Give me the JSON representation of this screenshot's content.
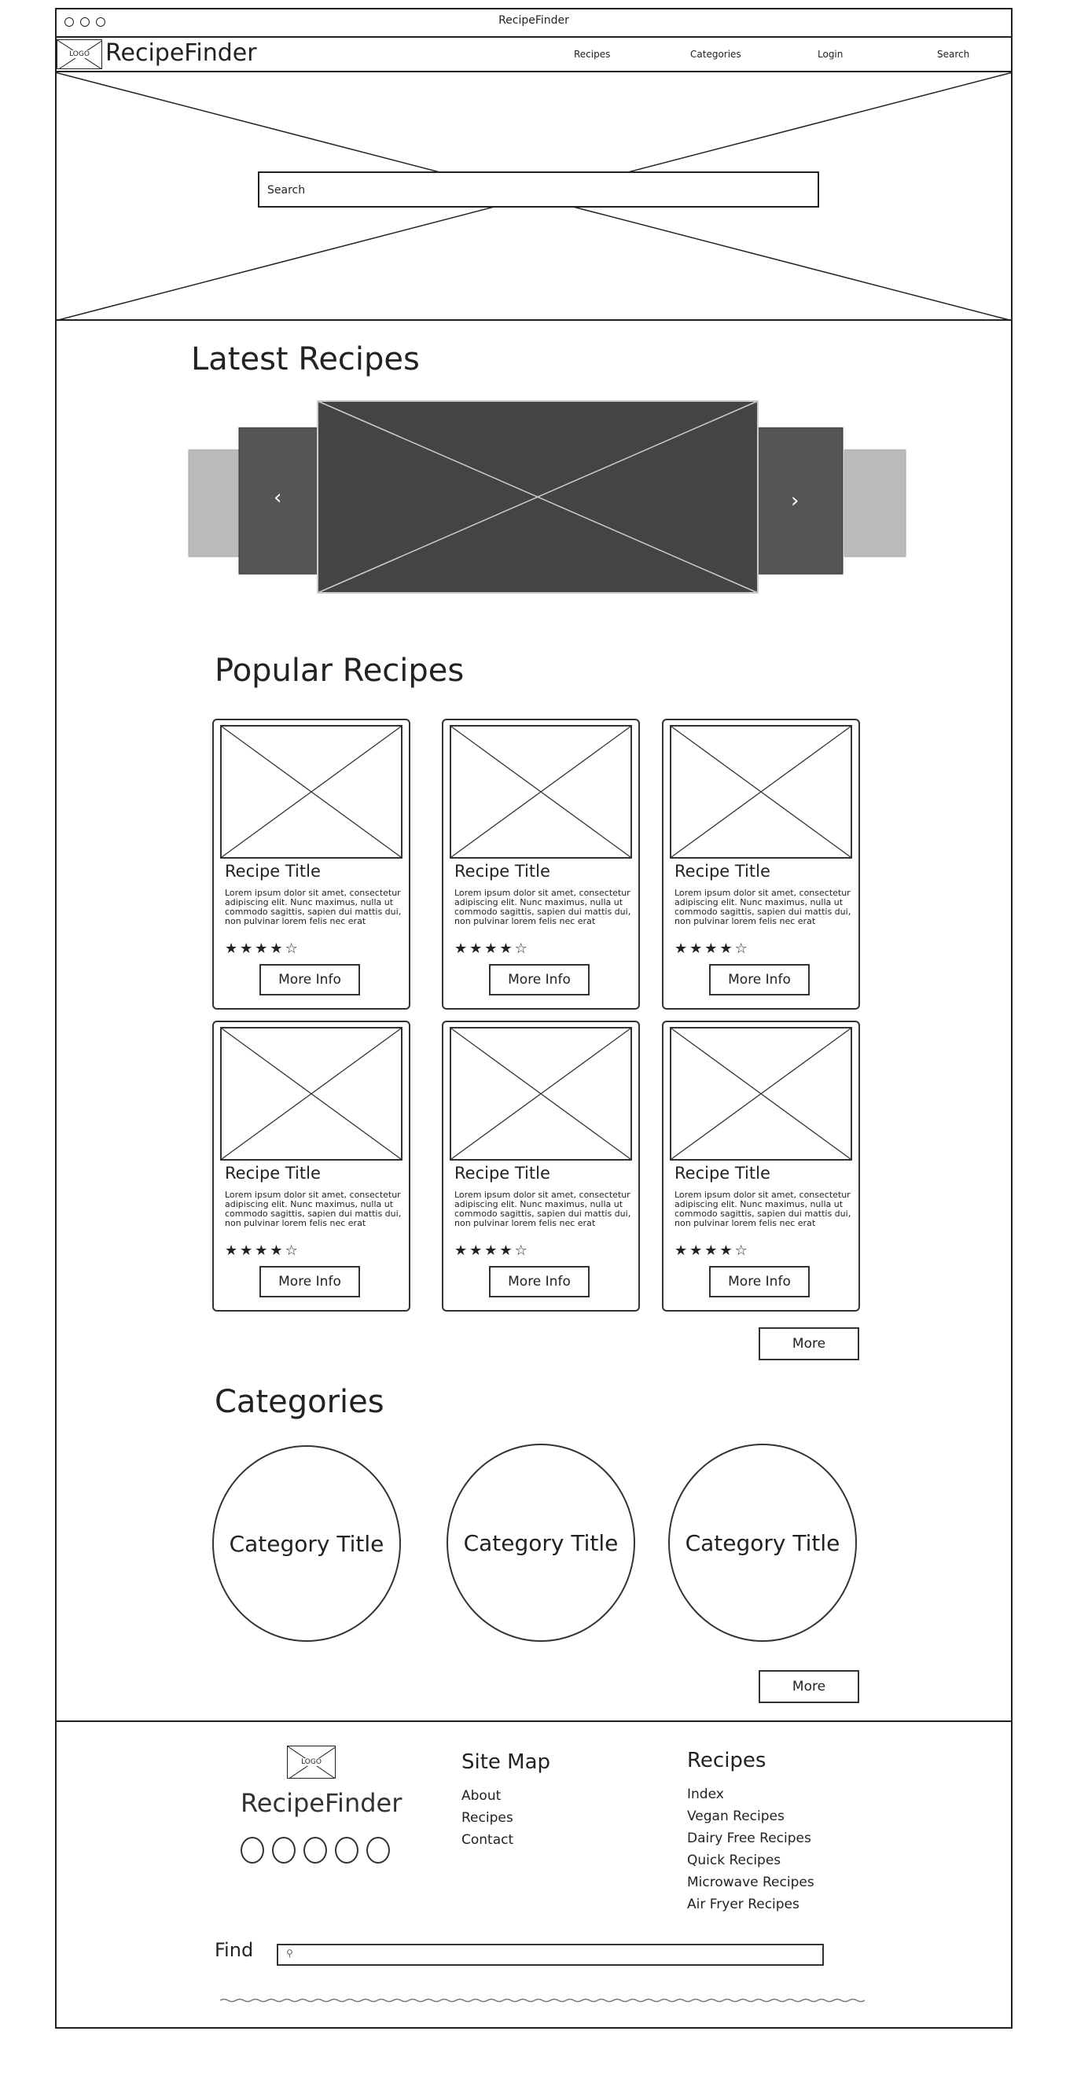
{
  "window": {
    "title": "RecipeFinder"
  },
  "nav": {
    "logo": "LOGO",
    "brand": "RecipeFinder",
    "links": [
      "Recipes",
      "Categories",
      "Login",
      "Search"
    ]
  },
  "hero": {
    "search_placeholder": "Search"
  },
  "latest": {
    "heading": "Latest Recipes",
    "prev": "‹",
    "next": "›"
  },
  "popular": {
    "heading": "Popular Recipes",
    "cards": [
      {
        "title": "Recipe Title",
        "text": "Lorem ipsum dolor sit amet, consectetur adipiscing elit. Nunc maximus, nulla ut commodo sagittis, sapien dui mattis dui, non pulvinar lorem felis nec erat",
        "rating": 4,
        "button": "More Info"
      },
      {
        "title": "Recipe Title",
        "text": "Lorem ipsum dolor sit amet, consectetur adipiscing elit. Nunc maximus, nulla ut commodo sagittis, sapien dui mattis dui, non pulvinar lorem felis nec erat",
        "rating": 4,
        "button": "More Info"
      },
      {
        "title": "Recipe Title",
        "text": "Lorem ipsum dolor sit amet, consectetur adipiscing elit. Nunc maximus, nulla ut commodo sagittis, sapien dui mattis dui, non pulvinar lorem felis nec erat",
        "rating": 4,
        "button": "More Info"
      },
      {
        "title": "Recipe Title",
        "text": "Lorem ipsum dolor sit amet, consectetur adipiscing elit. Nunc maximus, nulla ut commodo sagittis, sapien dui mattis dui, non pulvinar lorem felis nec erat",
        "rating": 4,
        "button": "More Info"
      },
      {
        "title": "Recipe Title",
        "text": "Lorem ipsum dolor sit amet, consectetur adipiscing elit. Nunc maximus, nulla ut commodo sagittis, sapien dui mattis dui, non pulvinar lorem felis nec erat",
        "rating": 4,
        "button": "More Info"
      },
      {
        "title": "Recipe Title",
        "text": "Lorem ipsum dolor sit amet, consectetur adipiscing elit. Nunc maximus, nulla ut commodo sagittis, sapien dui mattis dui, non pulvinar lorem felis nec erat",
        "rating": 4,
        "button": "More Info"
      }
    ],
    "more": "More"
  },
  "categories": {
    "heading": "Categories",
    "items": [
      "Category Title",
      "Category Title",
      "Category Title"
    ],
    "more": "More"
  },
  "footer": {
    "logo": "LOGO",
    "brand": "RecipeFinder",
    "sitemap": {
      "heading": "Site Map",
      "links": [
        "About",
        "Recipes",
        "Contact"
      ]
    },
    "recipes": {
      "heading": "Recipes",
      "links": [
        "Index",
        "Vegan Recipes",
        "Dairy Free Recipes",
        "Quick Recipes",
        "Microwave Recipes",
        "Air Fryer Recipes"
      ]
    },
    "find_label": "Find"
  }
}
